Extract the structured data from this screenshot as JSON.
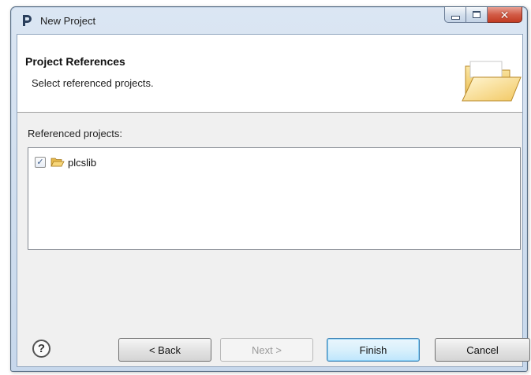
{
  "window": {
    "title": "New Project",
    "controls": {
      "minimize": "minimize-icon",
      "maximize": "maximize-icon",
      "close": "close-icon"
    }
  },
  "header": {
    "title": "Project References",
    "description": "Select referenced projects."
  },
  "references": {
    "label": "Referenced projects:",
    "items": [
      {
        "label": "plcslib",
        "checked": true,
        "icon": "folder-open-icon"
      }
    ]
  },
  "buttons": {
    "help": "?",
    "back": "< Back",
    "next": "Next >",
    "finish": "Finish",
    "cancel": "Cancel"
  },
  "colors": {
    "accent": "#3c7fb1",
    "close": "#c23b22",
    "folder": "#f3c75a"
  }
}
